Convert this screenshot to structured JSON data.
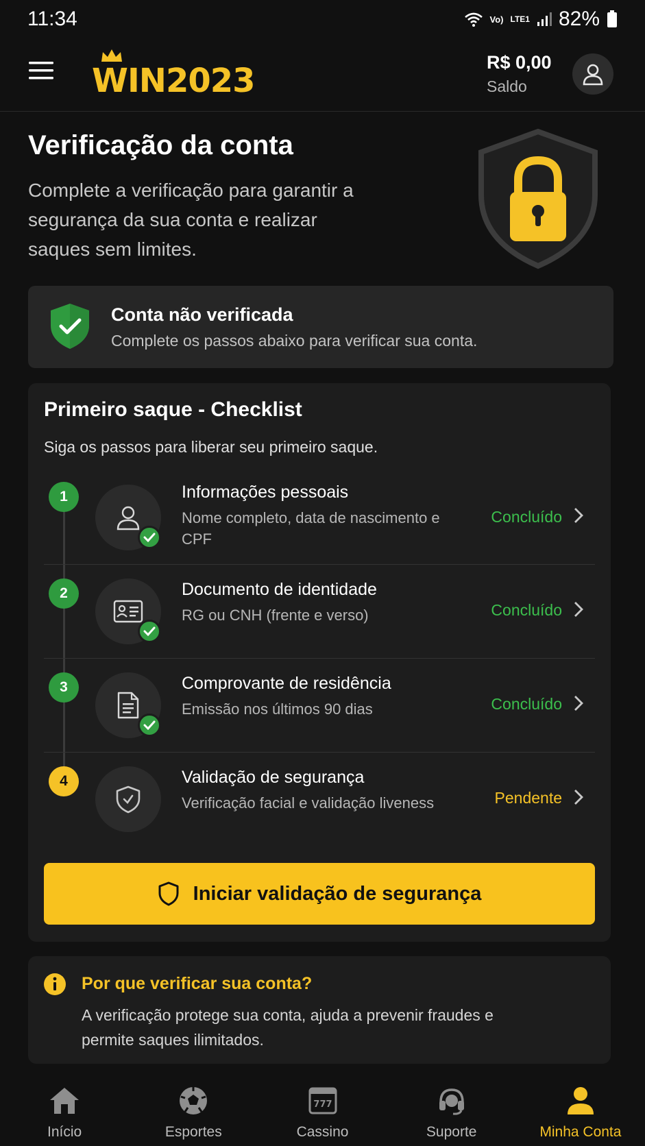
{
  "status_bar": {
    "time": "11:34",
    "battery": "82%",
    "network_labels": [
      "Vo)",
      "LTE1"
    ]
  },
  "header": {
    "logo_text": "WIN2023",
    "balance_value": "R$ 0,00",
    "balance_label": "Saldo"
  },
  "hero": {
    "title": "Verificação da conta",
    "subtitle": "Complete a verificação para garantir a segurança da sua conta e realizar saques sem limites."
  },
  "account_status": {
    "title": "Conta não verificada",
    "description": "Complete os passos abaixo para verificar sua conta."
  },
  "checklist": {
    "title": "Primeiro saque - Checklist",
    "subtitle": "Siga os passos para liberar seu primeiro saque.",
    "steps": [
      {
        "number": "1",
        "title": "Informações pessoais",
        "description": "Nome completo, data de nascimento e CPF",
        "status": "Concluído",
        "icon": "user-icon"
      },
      {
        "number": "2",
        "title": "Documento de identidade",
        "description": "RG ou CNH (frente e verso)",
        "status": "Concluído",
        "icon": "id-card-icon"
      },
      {
        "number": "3",
        "title": "Comprovante de residência",
        "description": "Emissão nos últimos 90 dias",
        "status": "Concluído",
        "icon": "document-icon"
      },
      {
        "number": "4",
        "title": "Validação de segurança",
        "description": "Verificação facial e validação liveness",
        "status": "Pendente",
        "icon": "shield-check-icon"
      }
    ],
    "cta_label": "Iniciar validação de segurança"
  },
  "info": {
    "title": "Por que verificar sua conta?",
    "text": "A verificação protege sua conta, ajuda a prevenir fraudes e permite saques ilimitados."
  },
  "bottom_nav": [
    {
      "label": "Início",
      "icon": "home-icon"
    },
    {
      "label": "Esportes",
      "icon": "soccer-ball-icon"
    },
    {
      "label": "Cassino",
      "icon": "slot-machine-icon"
    },
    {
      "label": "Suporte",
      "icon": "headset-icon"
    },
    {
      "label": "Minha Conta",
      "icon": "user-icon",
      "active": true
    }
  ],
  "colors": {
    "accent": "#f5c227",
    "success": "#3cbf4d",
    "background": "#111111",
    "card": "#1d1d1d"
  }
}
